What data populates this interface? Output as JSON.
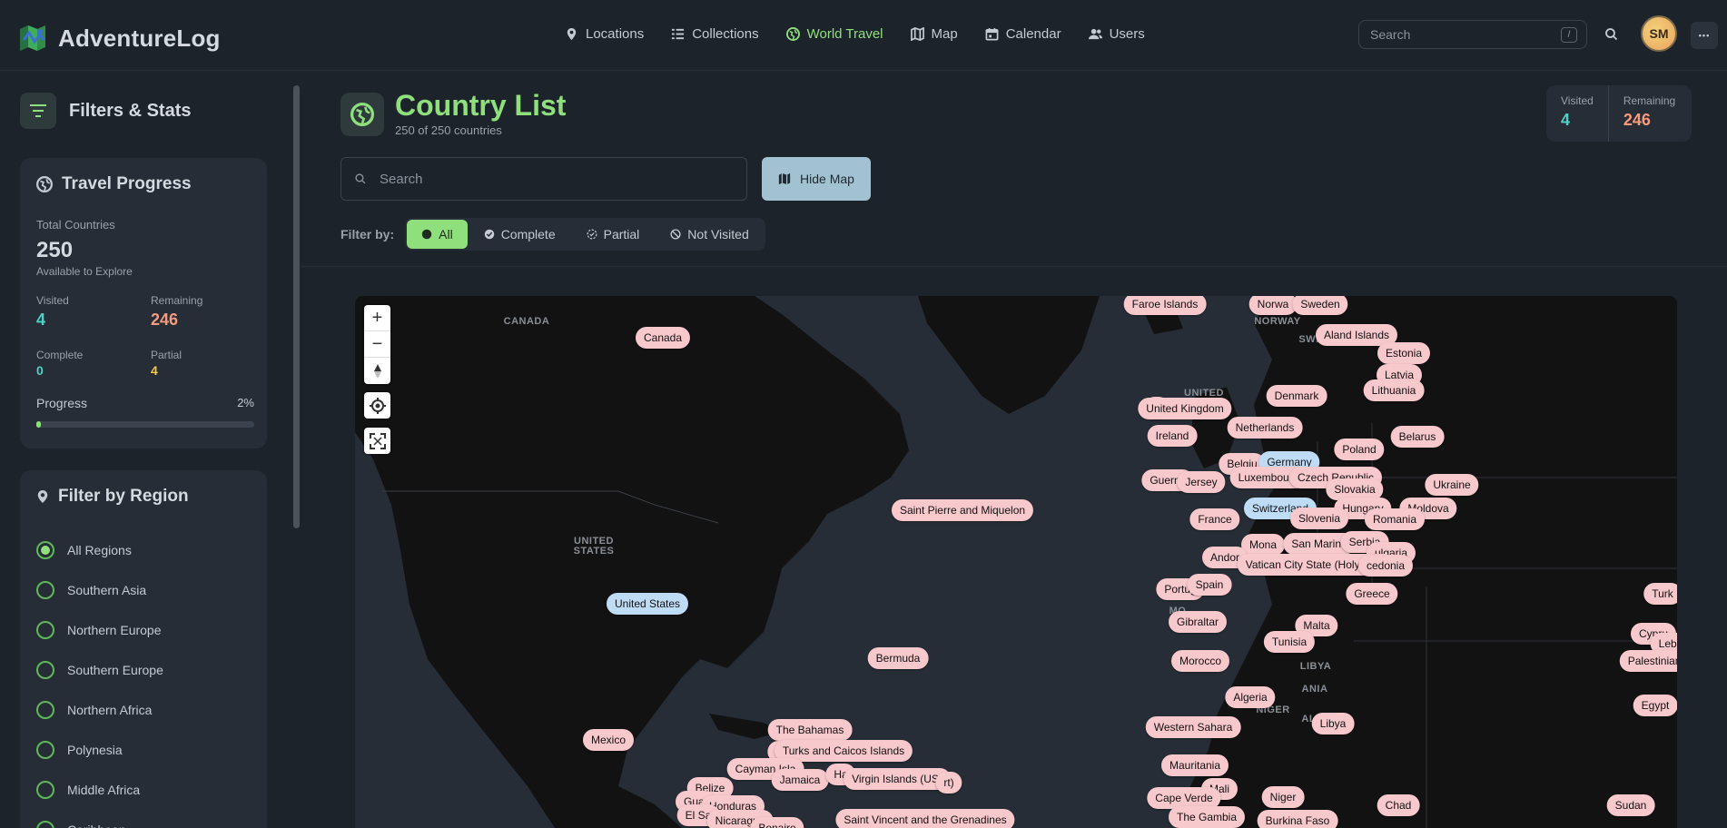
{
  "app": {
    "name": "AdventureLog"
  },
  "nav": [
    {
      "label": "Locations",
      "icon": "map-pin-icon",
      "active": false
    },
    {
      "label": "Collections",
      "icon": "list-icon",
      "active": false
    },
    {
      "label": "World Travel",
      "icon": "globe-icon",
      "active": true
    },
    {
      "label": "Map",
      "icon": "map-icon",
      "active": false
    },
    {
      "label": "Calendar",
      "icon": "calendar-icon",
      "active": false
    },
    {
      "label": "Users",
      "icon": "users-icon",
      "active": false
    }
  ],
  "header": {
    "search_placeholder": "Search",
    "search_shortcut": "/",
    "avatar_initials": "SM",
    "more_label": "•••"
  },
  "sidebar": {
    "title": "Filters & Stats",
    "progress": {
      "title": "Travel Progress",
      "total_label": "Total Countries",
      "total_value": "250",
      "total_sub": "Available to Explore",
      "visited_label": "Visited",
      "visited_value": "4",
      "remaining_label": "Remaining",
      "remaining_value": "246",
      "complete_label": "Complete",
      "complete_value": "0",
      "partial_label": "Partial",
      "partial_value": "4",
      "progress_label": "Progress",
      "progress_value": "2%",
      "progress_fraction": 0.02
    },
    "region": {
      "title": "Filter by Region",
      "items": [
        {
          "label": "All Regions",
          "checked": true
        },
        {
          "label": "Southern Asia",
          "checked": false
        },
        {
          "label": "Northern Europe",
          "checked": false
        },
        {
          "label": "Southern Europe",
          "checked": false
        },
        {
          "label": "Northern Africa",
          "checked": false
        },
        {
          "label": "Polynesia",
          "checked": false
        },
        {
          "label": "Middle Africa",
          "checked": false
        },
        {
          "label": "Caribbean",
          "checked": false
        }
      ]
    }
  },
  "main": {
    "title": "Country List",
    "subtitle": "250 of 250 countries",
    "stats": {
      "visited_label": "Visited",
      "visited_value": "4",
      "remaining_label": "Remaining",
      "remaining_value": "246"
    },
    "search_placeholder": "Search",
    "hide_map_label": "Hide Map",
    "filter_label": "Filter by:",
    "filters": [
      {
        "label": "All",
        "icon": "globe-icon",
        "active": true
      },
      {
        "label": "Complete",
        "icon": "check-circle-icon",
        "active": false
      },
      {
        "label": "Partial",
        "icon": "partial-circle-icon",
        "active": false
      },
      {
        "label": "Not Visited",
        "icon": "ban-icon",
        "active": false
      }
    ]
  },
  "colors": {
    "accent": "#8fe07d",
    "visited": "#4fd1c5",
    "remaining": "#f79b7f",
    "partial": "#f5c84c",
    "pin_not_visited": "#f7c8cc",
    "pin_visited": "#bfdcf7"
  },
  "map": {
    "zoom_in": "+",
    "zoom_out": "−",
    "labels": [
      "CANADA",
      "UNITED STATES",
      "NORWAY",
      "SWEDEN",
      "UNITED",
      "LIBYA",
      "NIGER",
      "MO",
      "ANIA",
      "ALI"
    ],
    "pins": [
      {
        "name": "Canada",
        "status": "not-visited"
      },
      {
        "name": "Faroe Islands",
        "status": "not-visited"
      },
      {
        "name": "Norwa",
        "status": "not-visited"
      },
      {
        "name": "Sweden",
        "status": "not-visited"
      },
      {
        "name": "Aland Islands",
        "status": "not-visited"
      },
      {
        "name": "Estonia",
        "status": "not-visited"
      },
      {
        "name": "Latvia",
        "status": "not-visited"
      },
      {
        "name": "Lithuania",
        "status": "not-visited"
      },
      {
        "name": "Denmark",
        "status": "not-visited"
      },
      {
        "name": "M",
        "status": "not-visited"
      },
      {
        "name": "United Kingdom",
        "status": "not-visited"
      },
      {
        "name": "Ireland",
        "status": "not-visited"
      },
      {
        "name": "Netherlands",
        "status": "not-visited"
      },
      {
        "name": "Belarus",
        "status": "not-visited"
      },
      {
        "name": "Poland",
        "status": "not-visited"
      },
      {
        "name": "Belgiu",
        "status": "not-visited"
      },
      {
        "name": "Germany",
        "status": "visited"
      },
      {
        "name": "Guerns",
        "status": "not-visited"
      },
      {
        "name": "Jersey",
        "status": "not-visited"
      },
      {
        "name": "Luxembourg",
        "status": "not-visited"
      },
      {
        "name": "Czech Republic",
        "status": "not-visited"
      },
      {
        "name": "Ukraine",
        "status": "not-visited"
      },
      {
        "name": "Slovakia",
        "status": "not-visited"
      },
      {
        "name": "Switzerland",
        "status": "visited"
      },
      {
        "name": "Hungary",
        "status": "not-visited"
      },
      {
        "name": "Moldova",
        "status": "not-visited"
      },
      {
        "name": "France",
        "status": "not-visited"
      },
      {
        "name": "Slovenia",
        "status": "not-visited"
      },
      {
        "name": "Romania",
        "status": "not-visited"
      },
      {
        "name": "Mona",
        "status": "not-visited"
      },
      {
        "name": "San Marino",
        "status": "not-visited"
      },
      {
        "name": "Serbia",
        "status": "not-visited"
      },
      {
        "name": "ulgaria",
        "status": "not-visited"
      },
      {
        "name": "Andor",
        "status": "not-visited"
      },
      {
        "name": "Vatican City State (Holy See)",
        "status": "not-visited"
      },
      {
        "name": "cedonia",
        "status": "not-visited"
      },
      {
        "name": "Saint Pierre and Miquelon",
        "status": "not-visited"
      },
      {
        "name": "Portug",
        "status": "not-visited"
      },
      {
        "name": "Spain",
        "status": "not-visited"
      },
      {
        "name": "Greece",
        "status": "not-visited"
      },
      {
        "name": "Turk",
        "status": "not-visited"
      },
      {
        "name": "United States",
        "status": "visited"
      },
      {
        "name": "Gibraltar",
        "status": "not-visited"
      },
      {
        "name": "Malta",
        "status": "not-visited"
      },
      {
        "name": "Cypru",
        "status": "not-visited"
      },
      {
        "name": "Tunisia",
        "status": "not-visited"
      },
      {
        "name": "Leba",
        "status": "not-visited"
      },
      {
        "name": "Morocco",
        "status": "not-visited"
      },
      {
        "name": "Palestinian Terr",
        "status": "not-visited"
      },
      {
        "name": "Bermuda",
        "status": "not-visited"
      },
      {
        "name": "Algeria",
        "status": "not-visited"
      },
      {
        "name": "Egypt",
        "status": "not-visited"
      },
      {
        "name": "Libya",
        "status": "not-visited"
      },
      {
        "name": "The Bahamas",
        "status": "not-visited"
      },
      {
        "name": "Western Sahara",
        "status": "not-visited"
      },
      {
        "name": "Mexico",
        "status": "not-visited"
      },
      {
        "name": "Cu",
        "status": "not-visited"
      },
      {
        "name": "Turks and Caicos Islands",
        "status": "not-visited"
      },
      {
        "name": "Mauritania",
        "status": "not-visited"
      },
      {
        "name": "Cayman Isla",
        "status": "not-visited"
      },
      {
        "name": "Jamaica",
        "status": "not-visited"
      },
      {
        "name": "Ha",
        "status": "not-visited"
      },
      {
        "name": "Virgin Islands (US)",
        "status": "not-visited"
      },
      {
        "name": "rt)",
        "status": "not-visited"
      },
      {
        "name": "Belize",
        "status": "not-visited"
      },
      {
        "name": "Mali",
        "status": "not-visited"
      },
      {
        "name": "Niger",
        "status": "not-visited"
      },
      {
        "name": "Chad",
        "status": "not-visited"
      },
      {
        "name": "Sudan",
        "status": "not-visited"
      },
      {
        "name": "Cape Verde",
        "status": "not-visited"
      },
      {
        "name": "Guat",
        "status": "not-visited"
      },
      {
        "name": "Honduras",
        "status": "not-visited"
      },
      {
        "name": "El Sa",
        "status": "not-visited"
      },
      {
        "name": "Nicaragua",
        "status": "not-visited"
      },
      {
        "name": "Bonaire",
        "status": "not-visited"
      },
      {
        "name": "Saint Vincent and the Grenadines",
        "status": "not-visited"
      },
      {
        "name": "The Gambia",
        "status": "not-visited"
      },
      {
        "name": "Burkina Faso",
        "status": "not-visited"
      }
    ]
  }
}
